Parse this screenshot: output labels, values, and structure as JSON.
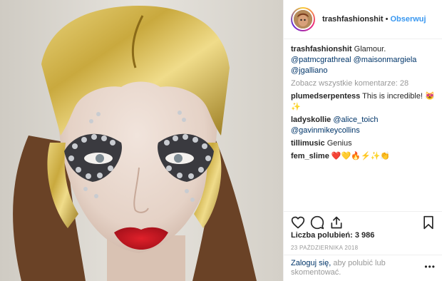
{
  "header": {
    "username": "trashfashionshit",
    "separator": "•",
    "follow_label": "Obserwuj"
  },
  "caption": {
    "username": "trashfashionshit",
    "text": "Glamour.",
    "mentions": [
      "@patmcgrathreal",
      "@maisonmargiela",
      "@jgalliano"
    ]
  },
  "view_all_comments": "Zobacz wszystkie komentarze: 28",
  "comments": [
    {
      "user": "plumedserpentess",
      "text": "This is incredible! 😻✨"
    },
    {
      "user": "ladyskollie",
      "mentions": [
        "@alice_toich",
        "@gavinmikeycollins"
      ]
    },
    {
      "user": "tillimusic",
      "text": "Genius"
    },
    {
      "user": "fem_slime",
      "text": "❤️💛🔥⚡✨👏"
    }
  ],
  "actions": {
    "like_icon": "heart-icon",
    "comment_icon": "comment-icon",
    "share_icon": "share-icon",
    "save_icon": "bookmark-icon"
  },
  "likes": "Liczba polubień: 3 986",
  "date": "23 PAŹDZIERNIKA 2018",
  "login": {
    "link": "Zaloguj się,",
    "text": " aby polubić lub skomentować.",
    "more_label": "•••"
  },
  "colors": {
    "follow": "#3897f0",
    "mention": "#003569",
    "muted": "#999999",
    "text": "#262626"
  }
}
